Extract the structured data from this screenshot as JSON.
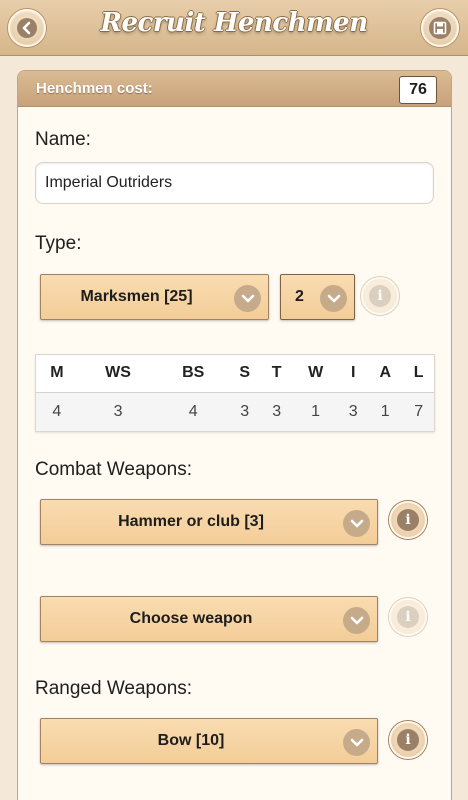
{
  "header": {
    "title": "Recruit Henchmen",
    "back_icon": "chevron-left-icon",
    "save_icon": "floppy-disk-icon"
  },
  "cost": {
    "label": "Henchmen cost:",
    "value": "76"
  },
  "name": {
    "label": "Name:",
    "value": "Imperial Outriders"
  },
  "type": {
    "label": "Type:",
    "selected": "Marksmen [25]",
    "count": "2"
  },
  "stats": {
    "headers": [
      "M",
      "WS",
      "BS",
      "S",
      "T",
      "W",
      "I",
      "A",
      "L"
    ],
    "values": [
      "4",
      "3",
      "4",
      "3",
      "3",
      "1",
      "3",
      "1",
      "7"
    ]
  },
  "combat": {
    "label": "Combat Weapons:",
    "weapon1": "Hammer or club [3]",
    "weapon2": "Choose weapon"
  },
  "ranged": {
    "label": "Ranged Weapons:",
    "weapon1": "Bow [10]"
  },
  "colors": {
    "header_bg": "#dcc099",
    "select_bg": "#f6d4a4",
    "panel_bg": "#fffaf2"
  }
}
